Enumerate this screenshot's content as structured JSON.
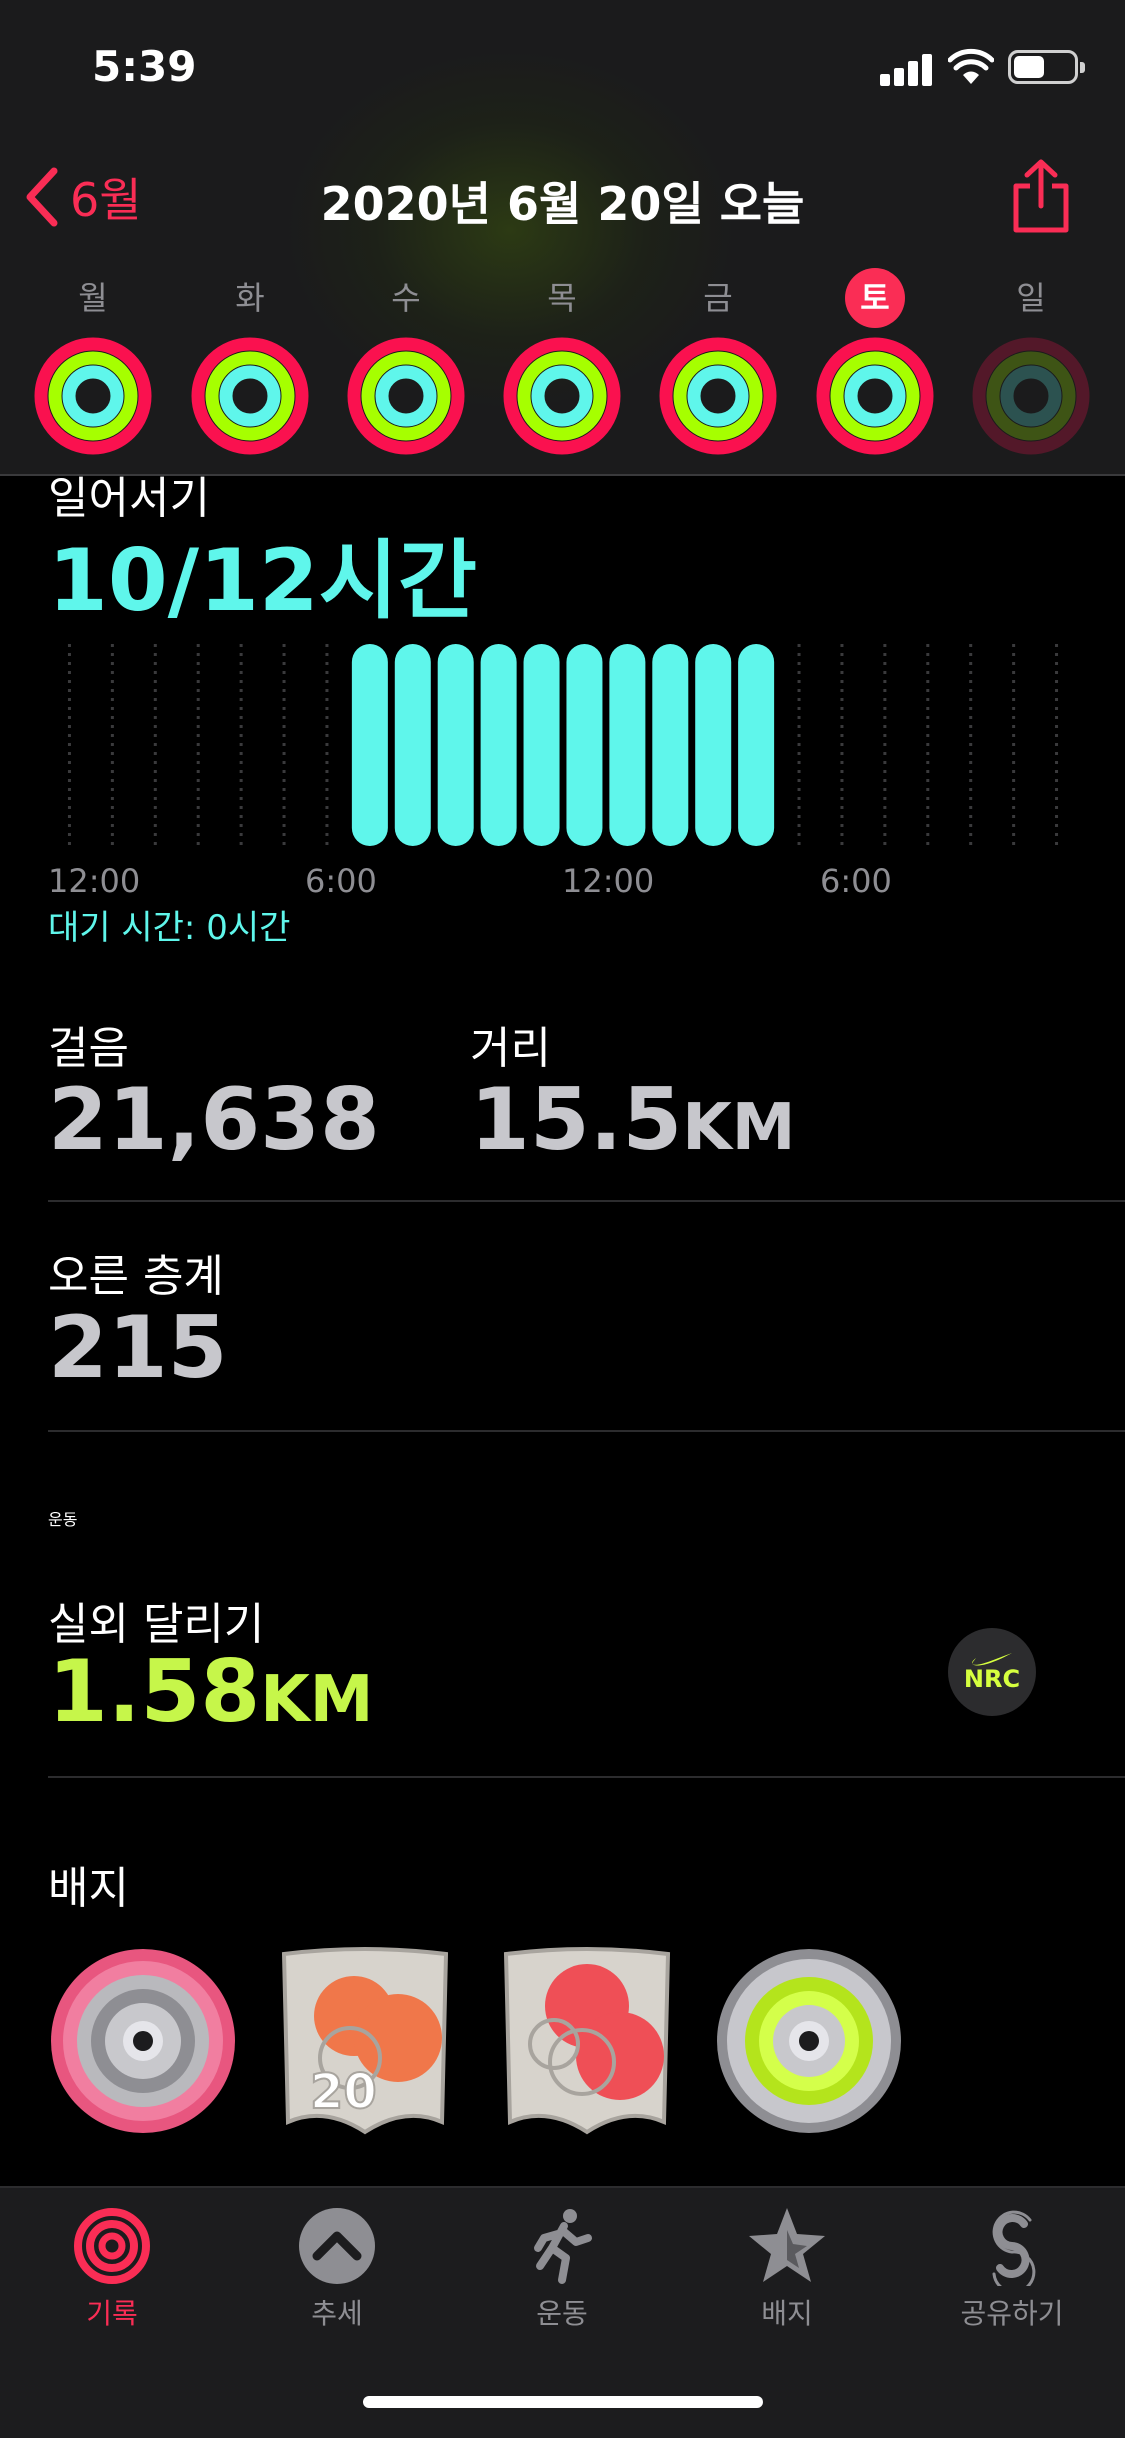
{
  "status": {
    "time": "5:39"
  },
  "nav": {
    "back_label": "6월",
    "title": "2020년 6월 20일 오늘"
  },
  "week": {
    "days": [
      "월",
      "화",
      "수",
      "목",
      "금",
      "토",
      "일"
    ],
    "today_index": 5
  },
  "stand": {
    "label": "일어서기",
    "value": "10/12시간",
    "hours_stood": [
      0,
      0,
      0,
      0,
      0,
      0,
      0,
      1,
      1,
      1,
      1,
      1,
      1,
      1,
      1,
      1,
      1,
      0,
      0,
      0,
      0,
      0,
      0,
      0
    ],
    "x_ticks": [
      "12:00",
      "6:00",
      "12:00",
      "6:00"
    ],
    "idle_text": "대기 시간: 0시간"
  },
  "steps": {
    "label": "걸음",
    "value": "21,638"
  },
  "distance": {
    "label": "거리",
    "value": "15.5",
    "unit": "KM"
  },
  "floors": {
    "label": "오른 층계",
    "value": "215"
  },
  "workouts": {
    "label": "운동",
    "items": [
      {
        "name": "실외 달리기",
        "value": "1.58",
        "unit": "KM",
        "app_badge": "NRC"
      }
    ]
  },
  "badges": {
    "label": "배지"
  },
  "tabs": [
    {
      "label": "기록",
      "icon": "activity-rings-icon",
      "active": true
    },
    {
      "label": "추세",
      "icon": "trend-chevron-icon",
      "active": false
    },
    {
      "label": "운동",
      "icon": "running-figure-icon",
      "active": false
    },
    {
      "label": "배지",
      "icon": "star-badge-icon",
      "active": false
    },
    {
      "label": "공유하기",
      "icon": "sharing-icon",
      "active": false
    }
  ],
  "colors": {
    "accent": "#fa2d55",
    "move": "#fa114f",
    "exercise": "#a6ff00",
    "stand": "#5ff6eb",
    "workout": "#c6f64a"
  }
}
